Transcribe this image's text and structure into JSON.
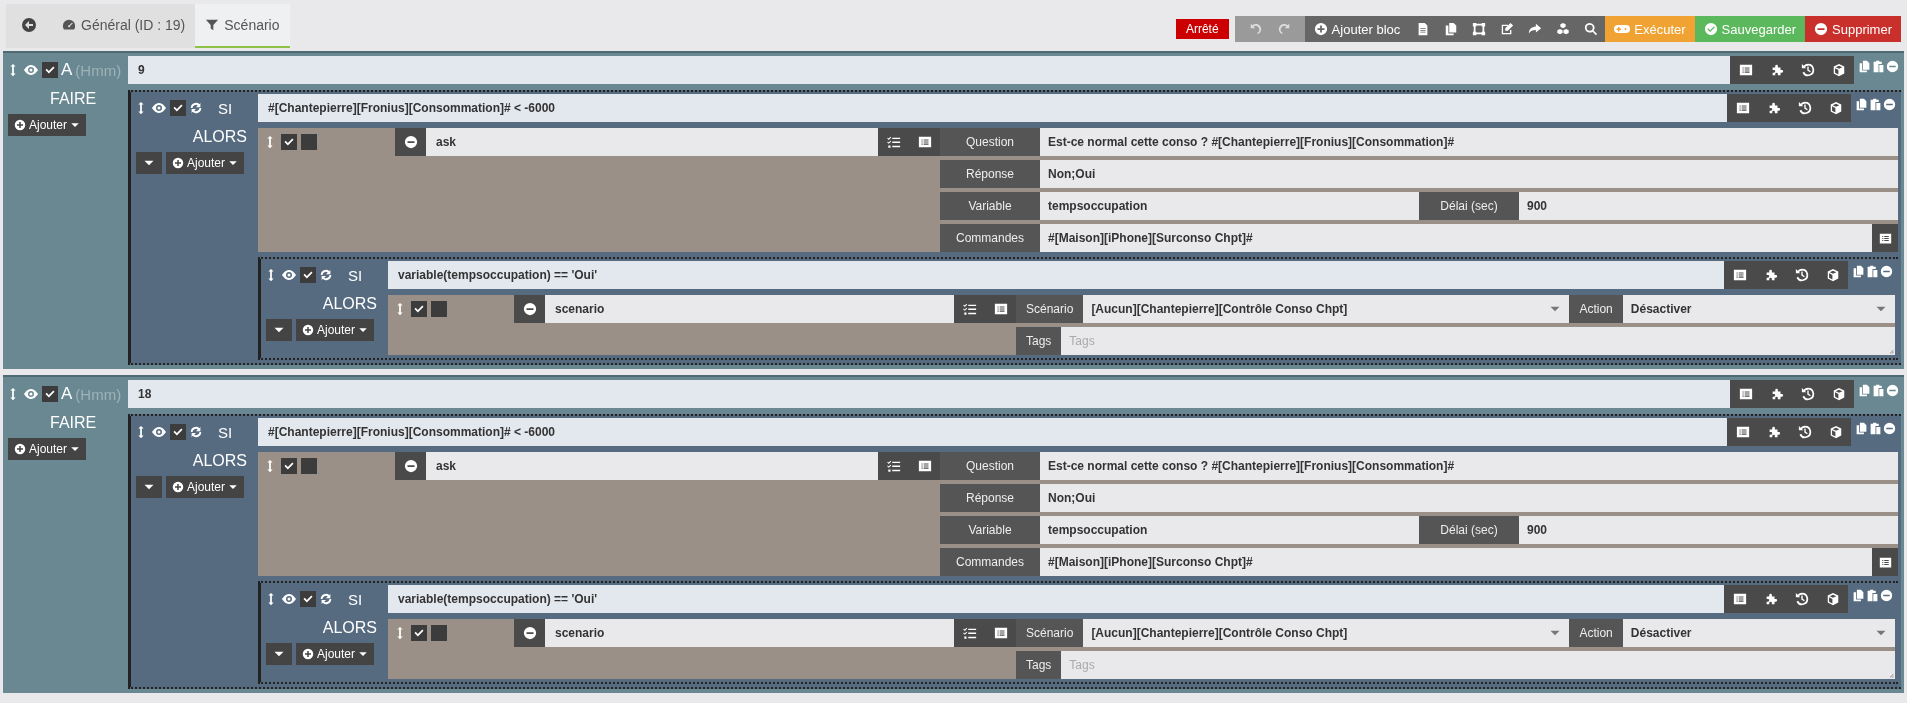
{
  "tabs": [
    {
      "label": "Général (ID : 19)",
      "kind": "dashboard",
      "selected": false
    },
    {
      "label": "Scénario",
      "kind": "filter",
      "selected": true
    }
  ],
  "toolbar": {
    "status": "Arrêté",
    "add_block": "Ajouter bloc",
    "run": "Exécuter",
    "save": "Sauvegarder",
    "delete": "Supprimer"
  },
  "blocks": [
    {
      "kind": "at",
      "keyword": "A",
      "hint": "(Hmm)",
      "value": "9",
      "enabled": true,
      "body_label": "FAIRE",
      "add_label": "Ajouter",
      "children": [
        {
          "kind": "if",
          "keyword": "SI",
          "condition": "#[Chantepierre][Fronius][Consommation]# < -6000",
          "enabled": true,
          "then_label": "ALORS",
          "add_label": "Ajouter",
          "actions": [
            {
              "kind": "ask",
              "name": "ask",
              "enabled": true,
              "parallel": false,
              "params": [
                {
                  "fields": [
                    {
                      "kind": "text",
                      "label": "Question",
                      "value": "Est-ce normal cette conso ? #[Chantepierre][Fronius][Consommation]#"
                    }
                  ]
                },
                {
                  "fields": [
                    {
                      "kind": "text",
                      "label": "Réponse",
                      "value": "Non;Oui"
                    }
                  ]
                },
                {
                  "fields": [
                    {
                      "kind": "text",
                      "label": "Variable",
                      "value": "tempsoccupation"
                    },
                    {
                      "kind": "text",
                      "label": "Délai (sec)",
                      "value": "900"
                    }
                  ]
                },
                {
                  "fields": [
                    {
                      "kind": "command",
                      "label": "Commandes",
                      "value": "#[Maison][iPhone][Surconso Chpt]#"
                    }
                  ]
                }
              ]
            },
            {
              "kind": "if",
              "keyword": "SI",
              "condition": "variable(tempsoccupation) == 'Oui'",
              "enabled": true,
              "then_label": "ALORS",
              "add_label": "Ajouter",
              "actions": [
                {
                  "kind": "scenario",
                  "name": "scenario",
                  "enabled": true,
                  "parallel": false,
                  "params": [
                    {
                      "fields": [
                        {
                          "kind": "select",
                          "label": "Scénario",
                          "value": "[Aucun][Chantepierre][Contrôle Conso Chpt]"
                        },
                        {
                          "kind": "select",
                          "label": "Action",
                          "value": "Désactiver"
                        }
                      ]
                    },
                    {
                      "fields": [
                        {
                          "kind": "tags",
                          "label": "Tags",
                          "placeholder": "Tags"
                        }
                      ]
                    }
                  ]
                }
              ]
            }
          ]
        }
      ]
    },
    {
      "kind": "at",
      "keyword": "A",
      "hint": "(Hmm)",
      "value": "18",
      "enabled": true,
      "body_label": "FAIRE",
      "add_label": "Ajouter",
      "children": [
        {
          "kind": "if",
          "keyword": "SI",
          "condition": "#[Chantepierre][Fronius][Consommation]# < -6000",
          "enabled": true,
          "then_label": "ALORS",
          "add_label": "Ajouter",
          "actions": [
            {
              "kind": "ask",
              "name": "ask",
              "enabled": true,
              "parallel": false,
              "params": [
                {
                  "fields": [
                    {
                      "kind": "text",
                      "label": "Question",
                      "value": "Est-ce normal cette conso ? #[Chantepierre][Fronius][Consommation]#"
                    }
                  ]
                },
                {
                  "fields": [
                    {
                      "kind": "text",
                      "label": "Réponse",
                      "value": "Non;Oui"
                    }
                  ]
                },
                {
                  "fields": [
                    {
                      "kind": "text",
                      "label": "Variable",
                      "value": "tempsoccupation"
                    },
                    {
                      "kind": "text",
                      "label": "Délai (sec)",
                      "value": "900"
                    }
                  ]
                },
                {
                  "fields": [
                    {
                      "kind": "command",
                      "label": "Commandes",
                      "value": "#[Maison][iPhone][Surconso Chpt]#"
                    }
                  ]
                }
              ]
            },
            {
              "kind": "if",
              "keyword": "SI",
              "condition": "variable(tempsoccupation) == 'Oui'",
              "enabled": true,
              "then_label": "ALORS",
              "add_label": "Ajouter",
              "actions": [
                {
                  "kind": "scenario",
                  "name": "scenario",
                  "enabled": true,
                  "parallel": false,
                  "params": [
                    {
                      "fields": [
                        {
                          "kind": "select",
                          "label": "Scénario",
                          "value": "[Aucun][Chantepierre][Contrôle Conso Chpt]"
                        },
                        {
                          "kind": "select",
                          "label": "Action",
                          "value": "Désactiver"
                        }
                      ]
                    },
                    {
                      "fields": [
                        {
                          "kind": "tags",
                          "label": "Tags",
                          "placeholder": "Tags"
                        }
                      ]
                    }
                  ]
                }
              ]
            }
          ]
        }
      ]
    }
  ]
}
